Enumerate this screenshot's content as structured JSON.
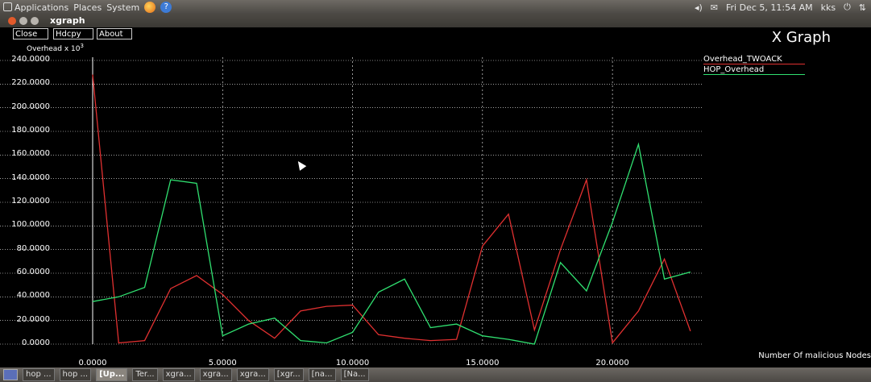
{
  "topbar": {
    "menus": [
      "Applications",
      "Places",
      "System"
    ],
    "datetime": "Fri Dec  5, 11:54 AM",
    "user": "kks"
  },
  "window": {
    "title": "xgraph"
  },
  "toolbar": {
    "close_label": "Close",
    "hdcpy_label": "Hdcpy",
    "about_label": "About"
  },
  "app_title": "X Graph",
  "chart_data": {
    "type": "line",
    "title": "X Graph",
    "ylabel": "Overhead x 10",
    "ylabel_exp": "3",
    "xlabel": "Number Of malicious Nodes",
    "xlim": [
      0,
      23.5
    ],
    "ylim": [
      0,
      240
    ],
    "x_ticks": [
      "0.0000",
      "5.0000",
      "10.0000",
      "15.0000",
      "20.0000"
    ],
    "y_ticks": [
      "0.0000",
      "20.0000",
      "40.0000",
      "60.0000",
      "80.0000",
      "100.0000",
      "120.0000",
      "140.0000",
      "160.0000",
      "180.0000",
      "200.0000",
      "220.0000",
      "240.0000"
    ],
    "grid": true,
    "legend": "top-right",
    "series": [
      {
        "name": "Overhead_TWOACK",
        "color": "#e03030",
        "x": [
          0,
          1,
          2,
          3,
          4,
          5,
          6,
          7,
          8,
          9,
          10,
          11,
          12,
          13,
          14,
          15,
          16,
          17,
          18,
          19,
          20,
          21,
          22,
          23
        ],
        "values": [
          228,
          1,
          3,
          47,
          58,
          42,
          20,
          5,
          28,
          32,
          33,
          8,
          5,
          3,
          4,
          83,
          110,
          12,
          80,
          139,
          1,
          28,
          72,
          11
        ]
      },
      {
        "name": "HOP_Overhead",
        "color": "#30e070",
        "x": [
          0,
          1,
          2,
          3,
          4,
          5,
          6,
          7,
          8,
          9,
          10,
          11,
          12,
          13,
          14,
          15,
          16,
          17,
          18,
          19,
          20,
          21,
          22,
          23
        ],
        "values": [
          36,
          40,
          48,
          139,
          136,
          7,
          17,
          22,
          3,
          1,
          10,
          44,
          55,
          14,
          17,
          7,
          4,
          0,
          69,
          45,
          103,
          169,
          55,
          61
        ]
      }
    ]
  },
  "taskbar": {
    "tasks": [
      "hop ...",
      "hop ...",
      "[Up...",
      "Ter...",
      "xgra...",
      "xgra...",
      "xgra...",
      "[xgr...",
      "[na...",
      "[Na..."
    ]
  }
}
